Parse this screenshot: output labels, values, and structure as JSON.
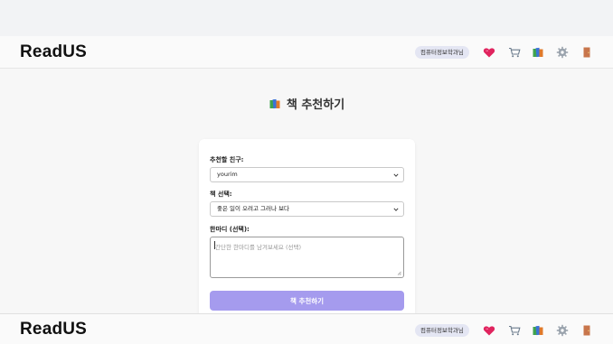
{
  "app": {
    "logo": "ReadUS"
  },
  "header": {
    "badge": "컴퓨터정보학과님"
  },
  "icons": [
    "heart-icon",
    "cart-icon",
    "books-icon",
    "gear-icon",
    "door-icon"
  ],
  "page": {
    "title": "책 추천하기"
  },
  "form": {
    "friend_label": "추천할 친구:",
    "friend_value": "yourim",
    "book_label": "책 선택:",
    "book_value": "좋은 일이 오려고 그러나 보다",
    "comment_label": "한마디 (선택):",
    "comment_placeholder": "간단한 한마디를 남겨보세요 (선택)",
    "submit_label": "책 추천하기"
  },
  "colors": {
    "accent": "#a59bee",
    "badge_bg": "#e4e6f3",
    "heart": "#e0245e"
  }
}
